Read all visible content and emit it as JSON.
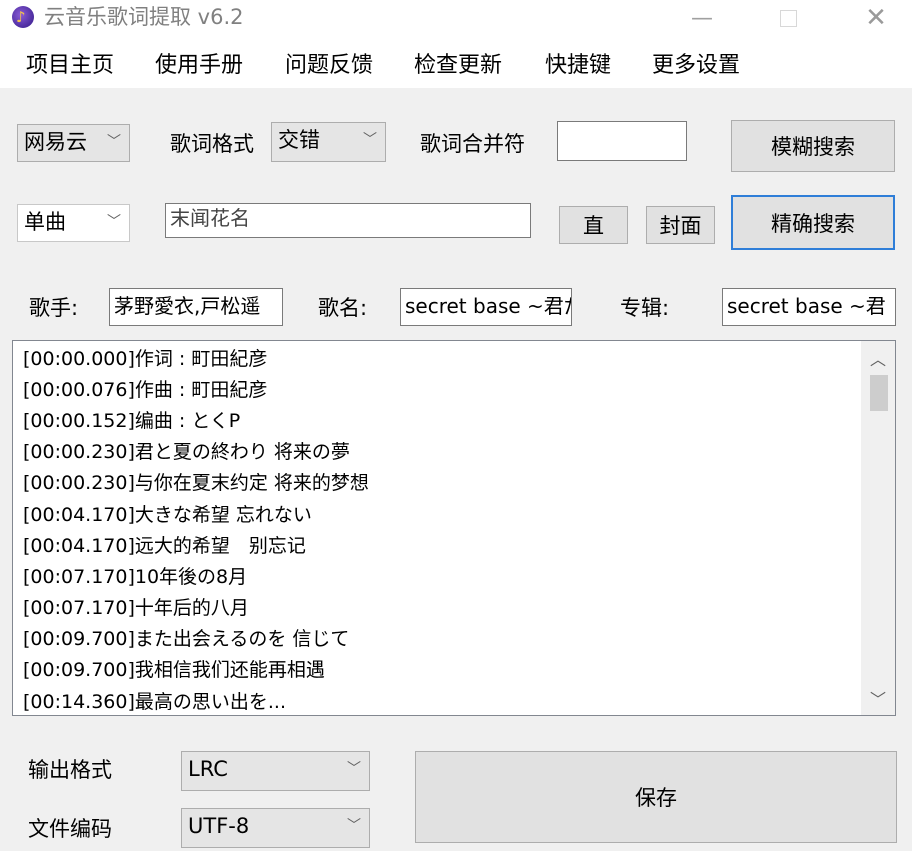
{
  "window": {
    "title": "云音乐歌词提取 v6.2",
    "minimize": "—",
    "close": "✕"
  },
  "menu": [
    "项目主页",
    "使用手册",
    "问题反馈",
    "检查更新",
    "快捷键",
    "更多设置"
  ],
  "search": {
    "source": "网易云",
    "lyric_format_label": "歌词格式",
    "lyric_format": "交错",
    "merge_symbol_label": "歌词合并符",
    "merge_symbol": "",
    "fuzzy_search": "模糊搜索",
    "mode": "单曲",
    "query": "末闻花名",
    "direct_button": "直",
    "cover_button": "封面",
    "exact_search": "精确搜索"
  },
  "song_info": {
    "singer_label": "歌手:",
    "singer": "茅野愛衣,戸松遥",
    "song_label": "歌名:",
    "song": "secret base ~君だ",
    "album_label": "专辑:",
    "album": "secret base ~君"
  },
  "lyrics": [
    "[00:00.000]作词 : 町田紀彦",
    "[00:00.076]作曲 : 町田紀彦",
    "[00:00.152]编曲 : とくP",
    "[00:00.230]君と夏の終わり 将来の夢",
    "[00:00.230]与你在夏末约定 将来的梦想",
    "[00:04.170]大きな希望 忘れない",
    "[00:04.170]远大的希望　别忘记",
    "[00:07.170]10年後の8月",
    "[00:07.170]十年后的八月",
    "[00:09.700]また出会えるのを 信じて",
    "[00:09.700]我相信我们还能再相遇",
    "[00:14.360]最高の思い出を..."
  ],
  "output": {
    "format_label": "输出格式",
    "format": "LRC",
    "encoding_label": "文件编码",
    "encoding": "UTF-8",
    "save": "保存"
  },
  "icons": {
    "chevron": "﹀"
  }
}
